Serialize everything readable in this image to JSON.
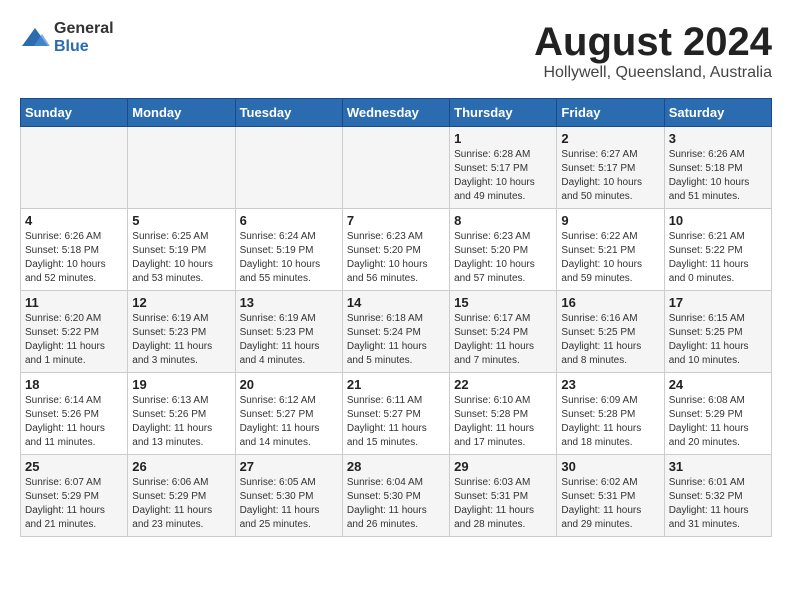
{
  "logo": {
    "general": "General",
    "blue": "Blue"
  },
  "title": {
    "month_year": "August 2024",
    "location": "Hollywell, Queensland, Australia"
  },
  "weekdays": [
    "Sunday",
    "Monday",
    "Tuesday",
    "Wednesday",
    "Thursday",
    "Friday",
    "Saturday"
  ],
  "weeks": [
    [
      {
        "day": "",
        "detail": ""
      },
      {
        "day": "",
        "detail": ""
      },
      {
        "day": "",
        "detail": ""
      },
      {
        "day": "",
        "detail": ""
      },
      {
        "day": "1",
        "detail": "Sunrise: 6:28 AM\nSunset: 5:17 PM\nDaylight: 10 hours\nand 49 minutes."
      },
      {
        "day": "2",
        "detail": "Sunrise: 6:27 AM\nSunset: 5:17 PM\nDaylight: 10 hours\nand 50 minutes."
      },
      {
        "day": "3",
        "detail": "Sunrise: 6:26 AM\nSunset: 5:18 PM\nDaylight: 10 hours\nand 51 minutes."
      }
    ],
    [
      {
        "day": "4",
        "detail": "Sunrise: 6:26 AM\nSunset: 5:18 PM\nDaylight: 10 hours\nand 52 minutes."
      },
      {
        "day": "5",
        "detail": "Sunrise: 6:25 AM\nSunset: 5:19 PM\nDaylight: 10 hours\nand 53 minutes."
      },
      {
        "day": "6",
        "detail": "Sunrise: 6:24 AM\nSunset: 5:19 PM\nDaylight: 10 hours\nand 55 minutes."
      },
      {
        "day": "7",
        "detail": "Sunrise: 6:23 AM\nSunset: 5:20 PM\nDaylight: 10 hours\nand 56 minutes."
      },
      {
        "day": "8",
        "detail": "Sunrise: 6:23 AM\nSunset: 5:20 PM\nDaylight: 10 hours\nand 57 minutes."
      },
      {
        "day": "9",
        "detail": "Sunrise: 6:22 AM\nSunset: 5:21 PM\nDaylight: 10 hours\nand 59 minutes."
      },
      {
        "day": "10",
        "detail": "Sunrise: 6:21 AM\nSunset: 5:22 PM\nDaylight: 11 hours\nand 0 minutes."
      }
    ],
    [
      {
        "day": "11",
        "detail": "Sunrise: 6:20 AM\nSunset: 5:22 PM\nDaylight: 11 hours\nand 1 minute."
      },
      {
        "day": "12",
        "detail": "Sunrise: 6:19 AM\nSunset: 5:23 PM\nDaylight: 11 hours\nand 3 minutes."
      },
      {
        "day": "13",
        "detail": "Sunrise: 6:19 AM\nSunset: 5:23 PM\nDaylight: 11 hours\nand 4 minutes."
      },
      {
        "day": "14",
        "detail": "Sunrise: 6:18 AM\nSunset: 5:24 PM\nDaylight: 11 hours\nand 5 minutes."
      },
      {
        "day": "15",
        "detail": "Sunrise: 6:17 AM\nSunset: 5:24 PM\nDaylight: 11 hours\nand 7 minutes."
      },
      {
        "day": "16",
        "detail": "Sunrise: 6:16 AM\nSunset: 5:25 PM\nDaylight: 11 hours\nand 8 minutes."
      },
      {
        "day": "17",
        "detail": "Sunrise: 6:15 AM\nSunset: 5:25 PM\nDaylight: 11 hours\nand 10 minutes."
      }
    ],
    [
      {
        "day": "18",
        "detail": "Sunrise: 6:14 AM\nSunset: 5:26 PM\nDaylight: 11 hours\nand 11 minutes."
      },
      {
        "day": "19",
        "detail": "Sunrise: 6:13 AM\nSunset: 5:26 PM\nDaylight: 11 hours\nand 13 minutes."
      },
      {
        "day": "20",
        "detail": "Sunrise: 6:12 AM\nSunset: 5:27 PM\nDaylight: 11 hours\nand 14 minutes."
      },
      {
        "day": "21",
        "detail": "Sunrise: 6:11 AM\nSunset: 5:27 PM\nDaylight: 11 hours\nand 15 minutes."
      },
      {
        "day": "22",
        "detail": "Sunrise: 6:10 AM\nSunset: 5:28 PM\nDaylight: 11 hours\nand 17 minutes."
      },
      {
        "day": "23",
        "detail": "Sunrise: 6:09 AM\nSunset: 5:28 PM\nDaylight: 11 hours\nand 18 minutes."
      },
      {
        "day": "24",
        "detail": "Sunrise: 6:08 AM\nSunset: 5:29 PM\nDaylight: 11 hours\nand 20 minutes."
      }
    ],
    [
      {
        "day": "25",
        "detail": "Sunrise: 6:07 AM\nSunset: 5:29 PM\nDaylight: 11 hours\nand 21 minutes."
      },
      {
        "day": "26",
        "detail": "Sunrise: 6:06 AM\nSunset: 5:29 PM\nDaylight: 11 hours\nand 23 minutes."
      },
      {
        "day": "27",
        "detail": "Sunrise: 6:05 AM\nSunset: 5:30 PM\nDaylight: 11 hours\nand 25 minutes."
      },
      {
        "day": "28",
        "detail": "Sunrise: 6:04 AM\nSunset: 5:30 PM\nDaylight: 11 hours\nand 26 minutes."
      },
      {
        "day": "29",
        "detail": "Sunrise: 6:03 AM\nSunset: 5:31 PM\nDaylight: 11 hours\nand 28 minutes."
      },
      {
        "day": "30",
        "detail": "Sunrise: 6:02 AM\nSunset: 5:31 PM\nDaylight: 11 hours\nand 29 minutes."
      },
      {
        "day": "31",
        "detail": "Sunrise: 6:01 AM\nSunset: 5:32 PM\nDaylight: 11 hours\nand 31 minutes."
      }
    ]
  ]
}
